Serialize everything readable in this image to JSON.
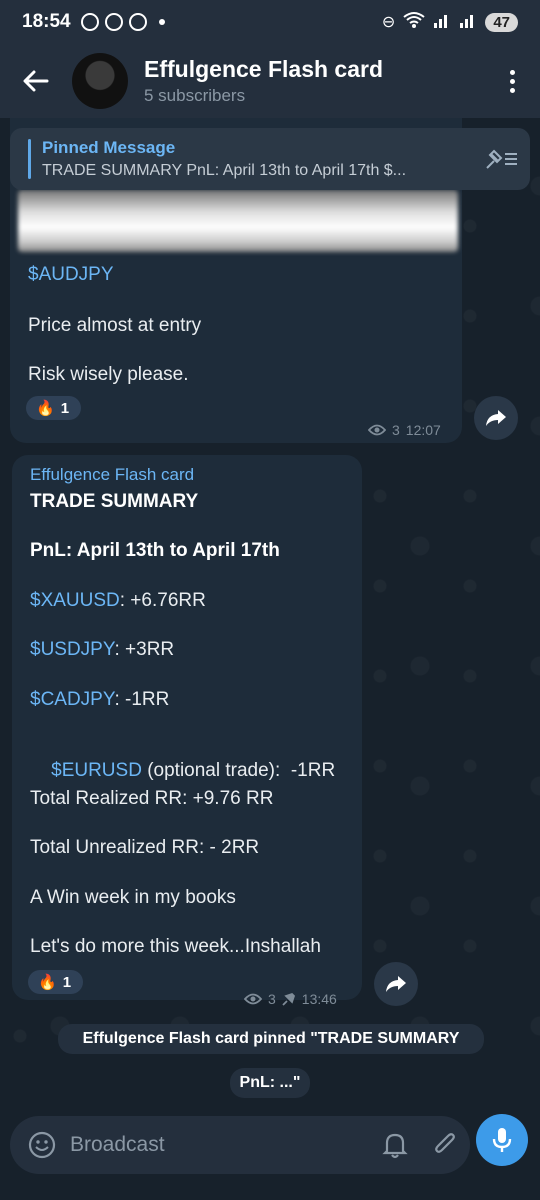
{
  "status_bar": {
    "time": "18:54",
    "battery": "47"
  },
  "header": {
    "title": "Effulgence Flash card",
    "subtitle": "5 subscribers"
  },
  "pinned": {
    "title": "Pinned Message",
    "text": "TRADE SUMMARY  PnL: April 13th to April 17th  $..."
  },
  "message1": {
    "ticker": "$AUDJPY",
    "line1": "Price almost at entry",
    "line2": "Risk wisely please.",
    "reaction_emoji": "🔥",
    "reaction_count": "1",
    "views": "3",
    "time": "12:07"
  },
  "message2": {
    "sender": "Effulgence Flash card",
    "title": "TRADE SUMMARY",
    "pnl": "PnL: April 13th to April 17th",
    "rows": [
      {
        "ticker": "$XAUUSD",
        "rest": ": +6.76RR"
      },
      {
        "ticker": "$USDJPY",
        "rest": ": +3RR"
      },
      {
        "ticker": "$CADJPY",
        "rest": ": -1RR"
      },
      {
        "ticker": "$EURUSD",
        "rest": " (optional trade):  -1RR"
      }
    ],
    "realized": "Total Realized RR: +9.76 RR",
    "unrealized": "Total Unrealized RR: - 2RR",
    "win": "A Win week in my books",
    "closing": "Let's do more this week...Inshallah",
    "reaction_emoji": "🔥",
    "reaction_count": "1",
    "views": "3",
    "time": "13:46"
  },
  "service": {
    "line1": "Effulgence Flash card pinned \"TRADE SUMMARY",
    "line2": "PnL: ...\""
  },
  "input": {
    "placeholder": "Broadcast"
  },
  "colors": {
    "accent": "#3d9be9",
    "link": "#6cb6f5",
    "bubble": "#1e2c3a"
  }
}
